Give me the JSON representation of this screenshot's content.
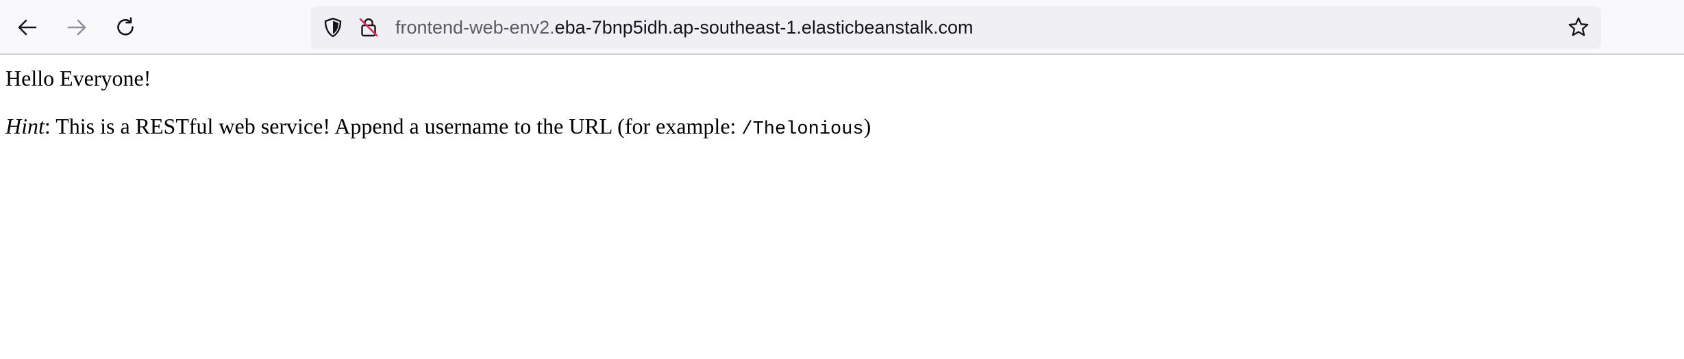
{
  "browser": {
    "url": {
      "subdomain": "frontend-web-env2.",
      "host": "eba-7bnp5idh.ap-southeast-1.elasticbeanstalk.com"
    },
    "icons": {
      "back": "arrow-left-icon",
      "forward": "arrow-right-icon",
      "reload": "reload-icon",
      "tracking_protection": "shield-icon",
      "insecure": "lock-slash-icon",
      "bookmark": "star-icon"
    },
    "colors": {
      "toolbar_bg": "#f9f9fb",
      "urlbar_bg": "#f0f0f4",
      "insecure_accent": "#e22850"
    }
  },
  "page": {
    "greeting": "Hello Everyone!",
    "hint": {
      "label": "Hint",
      "text": ": This is a RESTful web service! Append a username to the URL (for example: ",
      "example": "/Thelonious",
      "suffix": ")"
    }
  }
}
